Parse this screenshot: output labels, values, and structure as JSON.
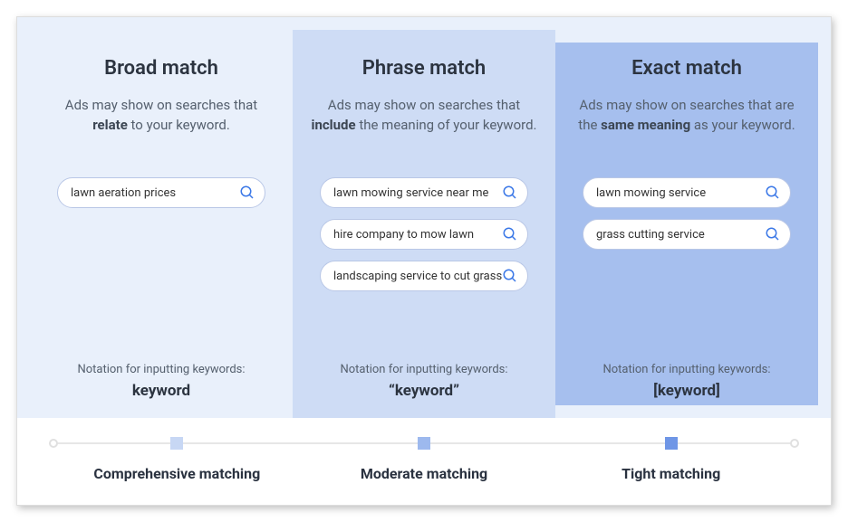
{
  "columns": [
    {
      "key": "broad",
      "title": "Broad match",
      "desc_pre": "Ads may show on searches that ",
      "desc_bold": "relate",
      "desc_post": " to your keyword.",
      "pills": [
        "lawn aeration prices"
      ],
      "notation_label": "Notation for inputting keywords:",
      "notation_value": "keyword",
      "axis_label": "Comprehensive matching"
    },
    {
      "key": "phrase",
      "title": "Phrase match",
      "desc_pre": "Ads may show on searches that ",
      "desc_bold": "include",
      "desc_post": " the meaning of your keyword.",
      "pills": [
        "lawn mowing service near me",
        "hire company to mow lawn",
        "landscaping service to cut grass"
      ],
      "notation_label": "Notation for inputting keywords:",
      "notation_value": "“keyword”",
      "axis_label": "Moderate matching"
    },
    {
      "key": "exact",
      "title": "Exact match",
      "desc_pre": "Ads may show on searches that are the ",
      "desc_bold": "same meaning",
      "desc_post": " as your keyword.",
      "pills": [
        "lawn mowing service",
        "grass cutting service"
      ],
      "notation_label": "Notation for inputting keywords:",
      "notation_value": "[keyword]",
      "axis_label": "Tight matching"
    }
  ]
}
